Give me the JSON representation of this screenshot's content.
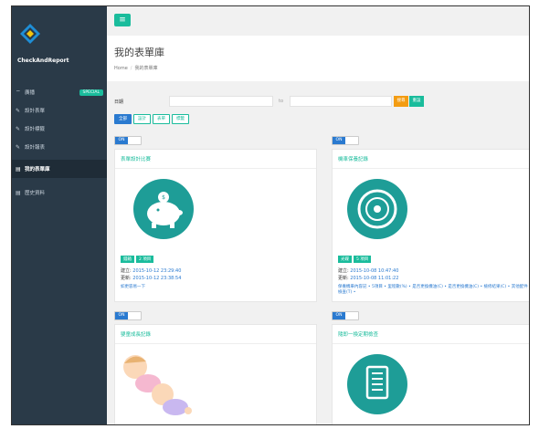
{
  "brand": {
    "name": "CheckAndReport"
  },
  "sidebar": {
    "special_badge": "SPECIAL",
    "items": [
      {
        "icon": "wifi-icon",
        "label": "廣播"
      },
      {
        "icon": "edit-icon",
        "label": "設計表單"
      },
      {
        "icon": "edit-icon",
        "label": "設計標籤"
      },
      {
        "icon": "edit-icon",
        "label": "設計報表"
      },
      {
        "icon": "list-icon",
        "label": "我的表單庫"
      },
      {
        "icon": "list-icon",
        "label": "歷史資料"
      }
    ]
  },
  "header": {
    "title": "我的表單庫",
    "breadcrumb": [
      "Home",
      "我的表單庫"
    ]
  },
  "filter": {
    "date_label": "日期",
    "to_label": "to",
    "search_label": "搜尋",
    "reset_label": "重設"
  },
  "tabs": [
    "全部",
    "設計",
    "表單",
    "標籤"
  ],
  "toggle_label": "ON",
  "cards": [
    {
      "title": "表單設計比賽",
      "tags": [
        "錢箱",
        "2 項目"
      ],
      "created_label": "建立:",
      "created": "2015-10-12 23:29:40",
      "updated_label": "更新:",
      "updated": "2015-10-12 23:38:54",
      "note": "如更容易一下"
    },
    {
      "title": "機車保養記錄",
      "tags": [
        "光碟",
        "5 項目"
      ],
      "created_label": "建立:",
      "created": "2015-10-08 10:47:40",
      "updated_label": "更新:",
      "updated": "2015-10-08 11:01:22",
      "note": "保養機車內容記 • 5項目 • 里程數(%) • 是否更換機油(C) • 是否更換機油(C) • 檢修結果(C) • 其他配件檢查(T) •"
    },
    {
      "title": "嬰童成長記錄",
      "tags": [],
      "note": ""
    },
    {
      "title": "隨即一換定期檢查",
      "tags": [],
      "note": ""
    }
  ],
  "colors": {
    "accent": "#1abc9c",
    "primary": "#2a7ad0",
    "sidebar": "#2a3a48",
    "warning": "#f39c12"
  }
}
